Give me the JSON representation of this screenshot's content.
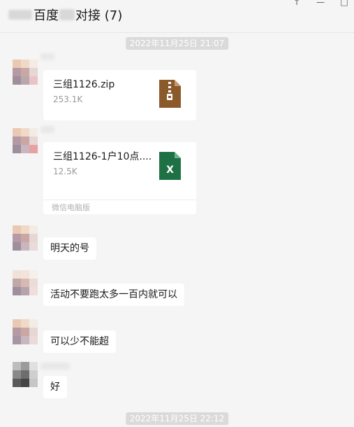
{
  "window": {
    "title_pre": "百度",
    "title_post": "对接 (7)",
    "controls": [
      "↑",
      "—",
      "□"
    ]
  },
  "timestamps": [
    "2022年11月25日 21:07",
    "2022年11月25日 22:12"
  ],
  "messages": [
    {
      "type": "file",
      "file_name": "三组1126.zip",
      "file_size": "253.1K",
      "file_icon": "zip-icon",
      "icon_color": "#8b5a2b"
    },
    {
      "type": "file",
      "file_name": "三组1126-1户10点....",
      "file_size": "12.5K",
      "file_icon": "excel-icon",
      "icon_color": "#1e7145",
      "footer": "微信电脑版"
    },
    {
      "type": "text",
      "text": "明天的号"
    },
    {
      "type": "text",
      "text": "活动不要跑太多一百内就可以"
    },
    {
      "type": "text",
      "text": "可以少不能超"
    },
    {
      "type": "text",
      "text": "好"
    }
  ]
}
